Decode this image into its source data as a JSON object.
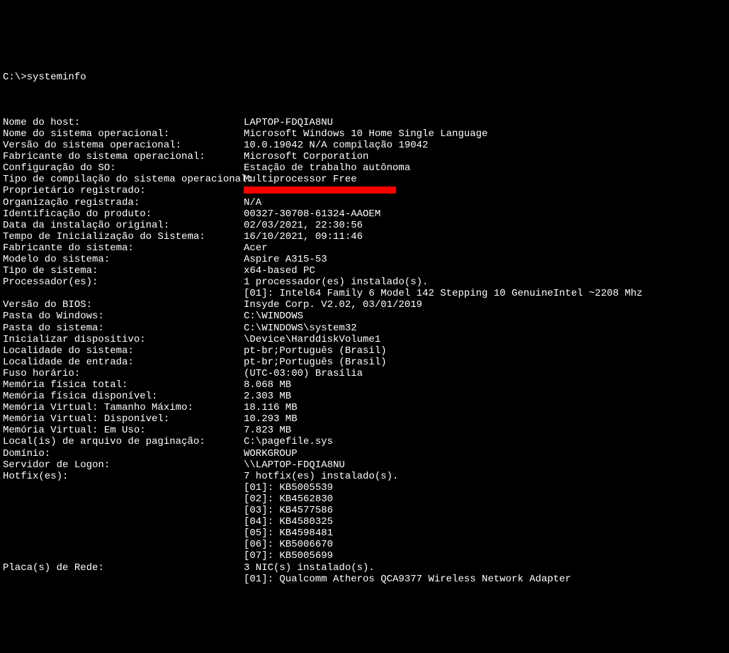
{
  "prompt": "C:\\>systeminfo",
  "rows": [
    {
      "label": "Nome do host:",
      "value": "LAPTOP-FDQIA8NU"
    },
    {
      "label": "Nome do sistema operacional:",
      "value": "Microsoft Windows 10 Home Single Language"
    },
    {
      "label": "Versão do sistema operacional:",
      "value": "10.0.19042 N/A compilação 19042"
    },
    {
      "label": "Fabricante do sistema operacional:",
      "value": "Microsoft Corporation"
    },
    {
      "label": "Configuração do SO:",
      "value": "Estação de trabalho autônoma"
    },
    {
      "label": "Tipo de compilação do sistema operacional:",
      "value": "Multiprocessor Free"
    },
    {
      "label": "Proprietário registrado:",
      "value": "",
      "redacted": true
    },
    {
      "label": "Organização registrada:",
      "value": "N/A"
    },
    {
      "label": "Identificação do produto:",
      "value": "00327-30708-61324-AAOEM"
    },
    {
      "label": "Data da instalação original:",
      "value": "02/03/2021, 22:30:56"
    },
    {
      "label": "Tempo de Inicialização do Sistema:",
      "value": "16/10/2021, 09:11:46"
    },
    {
      "label": "Fabricante do sistema:",
      "value": "Acer"
    },
    {
      "label": "Modelo do sistema:",
      "value": "Aspire A315-53"
    },
    {
      "label": "Tipo de sistema:",
      "value": "x64-based PC"
    },
    {
      "label": "Processador(es):",
      "value": "1 processador(es) instalado(s)."
    },
    {
      "label": "",
      "value": "[01]: Intel64 Family 6 Model 142 Stepping 10 GenuineIntel ~2208 Mhz"
    },
    {
      "label": "Versão do BIOS:",
      "value": "Insyde Corp. V2.02, 03/01/2019"
    },
    {
      "label": "Pasta do Windows:",
      "value": "C:\\WINDOWS"
    },
    {
      "label": "Pasta do sistema:",
      "value": "C:\\WINDOWS\\system32"
    },
    {
      "label": "Inicializar dispositivo:",
      "value": "\\Device\\HarddiskVolume1"
    },
    {
      "label": "Localidade do sistema:",
      "value": "pt-br;Português (Brasil)"
    },
    {
      "label": "Localidade de entrada:",
      "value": "pt-br;Português (Brasil)"
    },
    {
      "label": "Fuso horário:",
      "value": "(UTC-03:00) Brasília"
    },
    {
      "label": "Memória física total:",
      "value": "8.068 MB"
    },
    {
      "label": "Memória física disponível:",
      "value": "2.303 MB"
    },
    {
      "label": "Memória Virtual: Tamanho Máximo:",
      "value": "18.116 MB"
    },
    {
      "label": "Memória Virtual: Disponível:",
      "value": "10.293 MB"
    },
    {
      "label": "Memória Virtual: Em Uso:",
      "value": "7.823 MB"
    },
    {
      "label": "Local(is) de arquivo de paginação:",
      "value": "C:\\pagefile.sys"
    },
    {
      "label": "Domínio:",
      "value": "WORKGROUP"
    },
    {
      "label": "Servidor de Logon:",
      "value": "\\\\LAPTOP-FDQIA8NU"
    },
    {
      "label": "Hotfix(es):",
      "value": "7 hotfix(es) instalado(s)."
    },
    {
      "label": "",
      "value": "[01]: KB5005539"
    },
    {
      "label": "",
      "value": "[02]: KB4562830"
    },
    {
      "label": "",
      "value": "[03]: KB4577586"
    },
    {
      "label": "",
      "value": "[04]: KB4580325"
    },
    {
      "label": "",
      "value": "[05]: KB4598481"
    },
    {
      "label": "",
      "value": "[06]: KB5006670"
    },
    {
      "label": "",
      "value": "[07]: KB5005699"
    },
    {
      "label": "Placa(s) de Rede:",
      "value": "3 NIC(s) instalado(s)."
    },
    {
      "label": "",
      "value": "[01]: Qualcomm Atheros QCA9377 Wireless Network Adapter"
    }
  ]
}
